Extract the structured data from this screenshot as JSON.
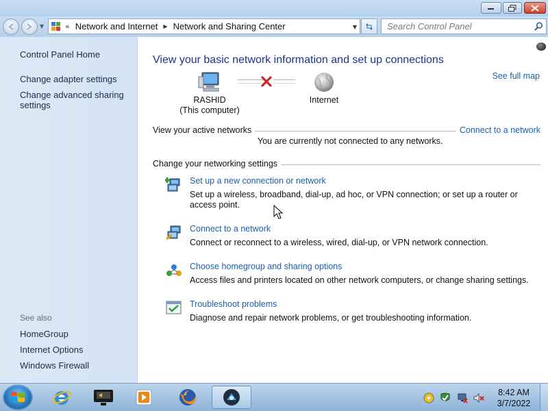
{
  "window": {
    "minimize_icon": "minimize-icon",
    "maximize_icon": "restore-icon",
    "close_icon": "close-icon"
  },
  "navigation": {
    "breadcrumb": [
      "Network and Internet",
      "Network and Sharing Center"
    ],
    "search_placeholder": "Search Control Panel"
  },
  "sidebar": {
    "home": "Control Panel Home",
    "links": [
      "Change adapter settings",
      "Change advanced sharing",
      "settings"
    ],
    "see_also_label": "See also",
    "see_also": [
      "HomeGroup",
      "Internet Options",
      "Windows Firewall"
    ]
  },
  "main": {
    "title": "View your basic network information and set up connections",
    "see_full_map": "See full map",
    "computer_name": "RASHID",
    "computer_sub": "(This computer)",
    "internet_label": "Internet",
    "active_networks_title": "View your active networks",
    "connect_link": "Connect to a network",
    "not_connected": "You are currently not connected to any networks.",
    "settings_title": "Change your networking settings",
    "tasks": [
      {
        "link": "Set up a new connection or network",
        "desc": "Set up a wireless, broadband, dial-up, ad hoc, or VPN connection; or set up a router or access point."
      },
      {
        "link": "Connect to a network",
        "desc": "Connect or reconnect to a wireless, wired, dial-up, or VPN network connection."
      },
      {
        "link": "Choose homegroup and sharing options",
        "desc": "Access files and printers located on other network computers, or change sharing settings."
      },
      {
        "link": "Troubleshoot problems",
        "desc": "Diagnose and repair network problems, or get troubleshooting information."
      }
    ]
  },
  "taskbar": {
    "apps": [
      "internet-explorer-icon",
      "media-center-icon",
      "media-player-icon",
      "firefox-icon",
      "network-center-icon"
    ],
    "time": "8:42 AM",
    "date": "3/7/2022"
  },
  "colors": {
    "link": "#1b5fab",
    "title": "#1e3287",
    "sidebar_bg": "#d8e6f5"
  }
}
